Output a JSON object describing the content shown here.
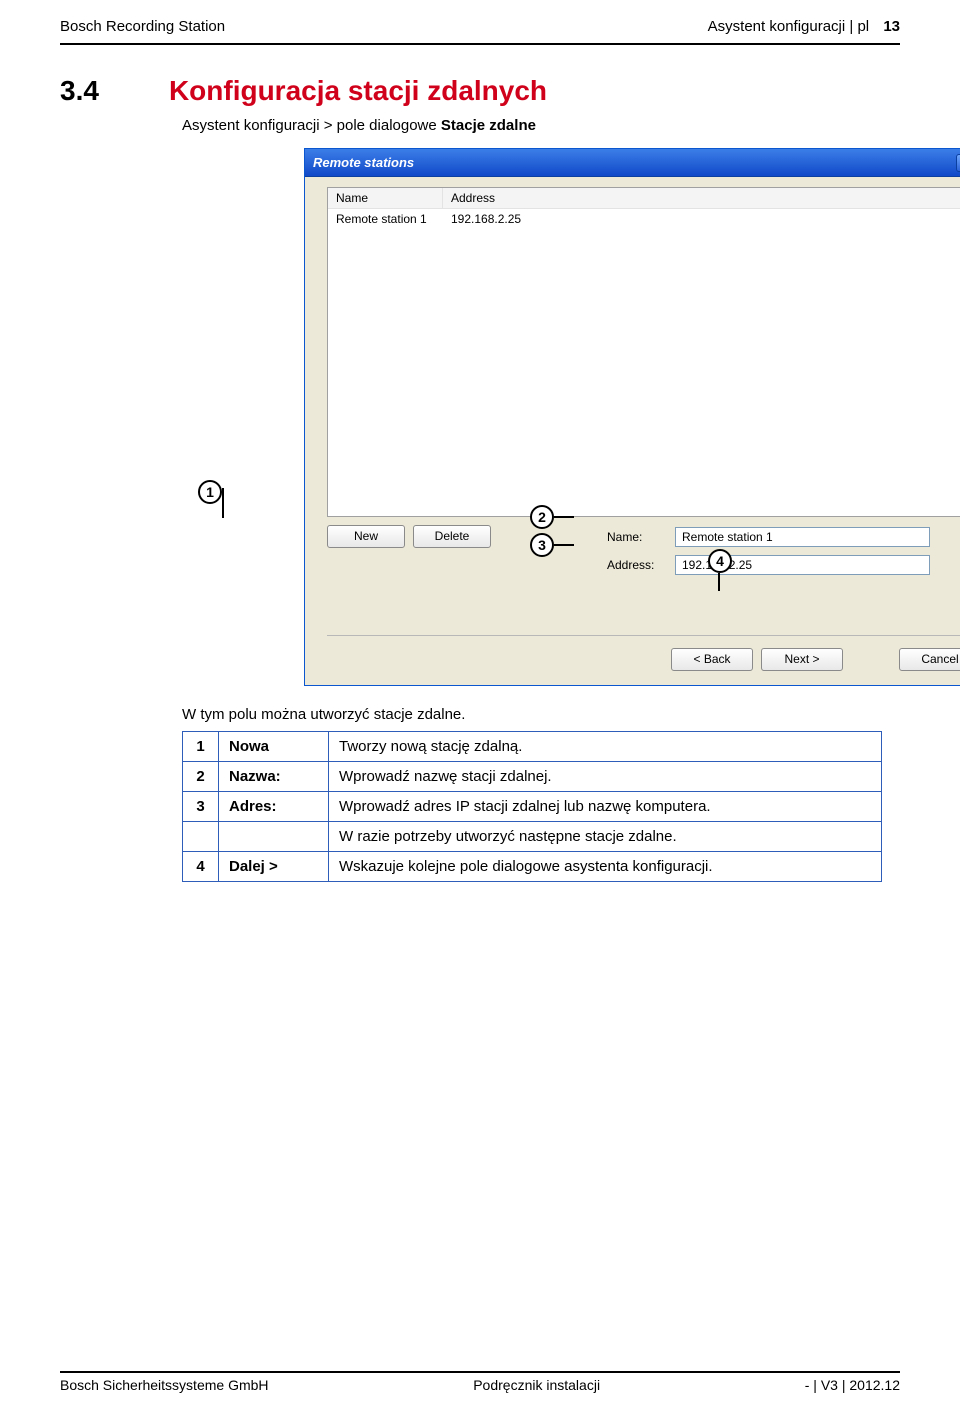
{
  "header": {
    "left": "Bosch Recording Station",
    "right_title": "Asystent konfiguracji | pl",
    "page_number": "13"
  },
  "section": {
    "number": "3.4",
    "title": "Konfiguracja stacji zdalnych",
    "path_prefix": "Asystent konfiguracji > pole dialogowe ",
    "path_bold": "Stacje zdalne"
  },
  "dialog": {
    "title": "Remote stations",
    "columns": {
      "name": "Name",
      "address": "Address"
    },
    "rows": [
      {
        "name": "Remote station 1",
        "address": "192.168.2.25"
      }
    ],
    "buttons": {
      "new": "New",
      "delete": "Delete"
    },
    "fields": {
      "name_label": "Name:",
      "name_value": "Remote station 1",
      "address_label": "Address:",
      "address_value": "192.168.2.25"
    },
    "nav": {
      "back": "< Back",
      "next": "Next >",
      "cancel": "Cancel"
    }
  },
  "callouts": {
    "c1": "1",
    "c2": "2",
    "c3": "3",
    "c4": "4"
  },
  "body_text": "W tym polu można utworzyć stacje zdalne.",
  "legend": {
    "r1": {
      "num": "1",
      "label": "Nowa",
      "desc": "Tworzy nową stację zdalną."
    },
    "r2": {
      "num": "2",
      "label": "Nazwa:",
      "desc": "Wprowadź nazwę stacji zdalnej."
    },
    "r3": {
      "num": "3",
      "label": "Adres:",
      "desc": "Wprowadź adres IP stacji zdalnej lub nazwę komputera."
    },
    "r3b": {
      "desc": "W razie potrzeby utworzyć następne stacje zdalne."
    },
    "r4": {
      "num": "4",
      "label": "Dalej >",
      "desc": "Wskazuje kolejne pole dialogowe asystenta konfiguracji."
    }
  },
  "footer": {
    "left": "Bosch Sicherheitssysteme GmbH",
    "center": "Podręcznik instalacji",
    "right": "- | V3 | 2012.12"
  }
}
